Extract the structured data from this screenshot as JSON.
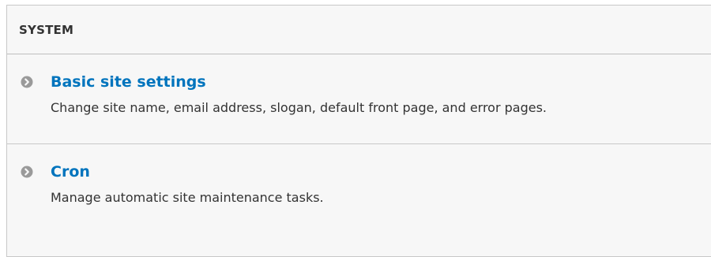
{
  "section": {
    "title": "SYSTEM"
  },
  "items": [
    {
      "title": "Basic site settings",
      "description": "Change site name, email address, slogan, default front page, and error pages.",
      "icon": "chevron-right-circle-icon"
    },
    {
      "title": "Cron",
      "description": "Manage automatic site maintenance tasks.",
      "icon": "chevron-right-circle-icon"
    }
  ],
  "colors": {
    "link": "#0074bd",
    "text": "#333333",
    "panel_bg": "#f7f7f7",
    "divider": "#c8c8c8",
    "bullet": "#9a9a9a"
  }
}
